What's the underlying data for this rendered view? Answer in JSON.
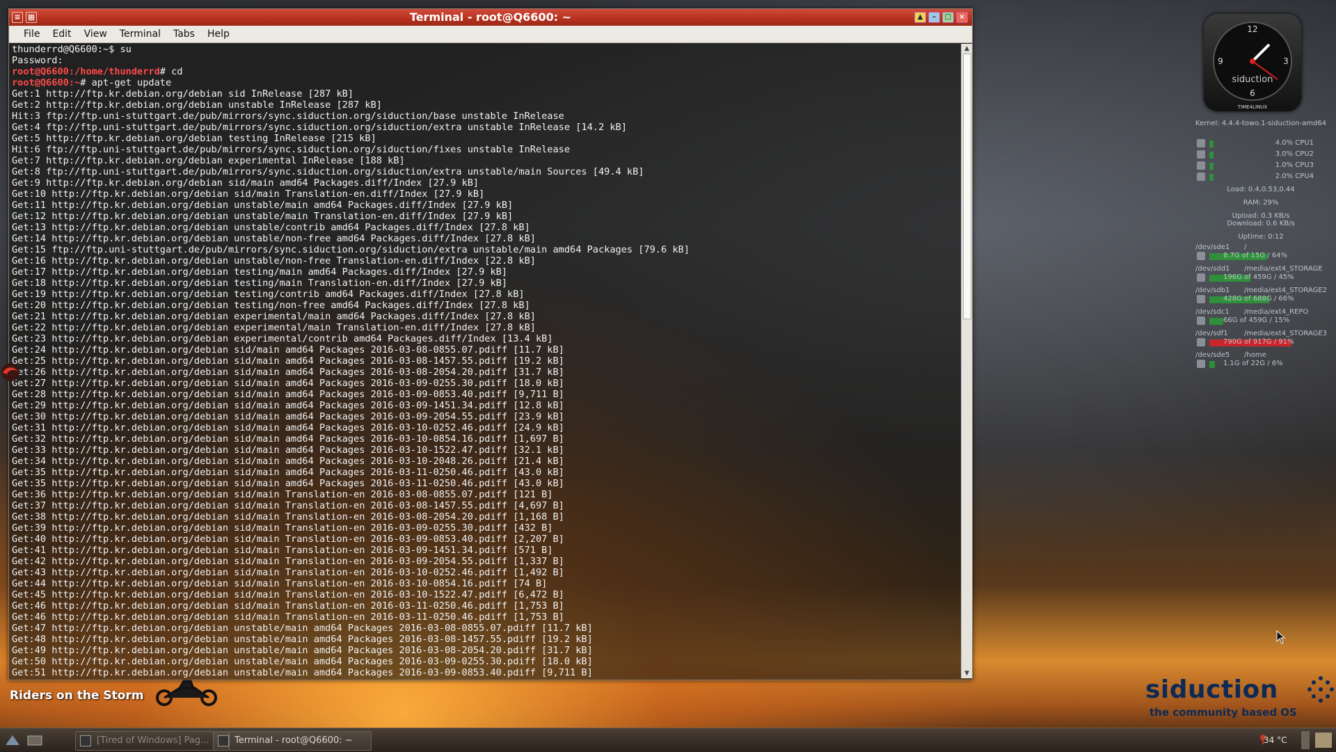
{
  "window": {
    "title": "Terminal - root@Q6600: ~",
    "menu": [
      "File",
      "Edit",
      "View",
      "Terminal",
      "Tabs",
      "Help"
    ]
  },
  "terminal": {
    "lines": [
      {
        "prompt": "",
        "text": "thunderrd@Q6600:~$ su"
      },
      {
        "prompt": "",
        "text": "Password:"
      },
      {
        "prompt": "root@Q6600:/home/thunderrd",
        "text": "# cd"
      },
      {
        "prompt": "root@Q6600:~",
        "text": "# apt-get update"
      },
      {
        "prompt": "",
        "text": "Get:1 http://ftp.kr.debian.org/debian sid InRelease [287 kB]"
      },
      {
        "prompt": "",
        "text": "Get:2 http://ftp.kr.debian.org/debian unstable InRelease [287 kB]"
      },
      {
        "prompt": "",
        "text": "Hit:3 ftp://ftp.uni-stuttgart.de/pub/mirrors/sync.siduction.org/siduction/base unstable InRelease"
      },
      {
        "prompt": "",
        "text": "Get:4 ftp://ftp.uni-stuttgart.de/pub/mirrors/sync.siduction.org/siduction/extra unstable InRelease [14.2 kB]"
      },
      {
        "prompt": "",
        "text": "Get:5 http://ftp.kr.debian.org/debian testing InRelease [215 kB]"
      },
      {
        "prompt": "",
        "text": "Hit:6 ftp://ftp.uni-stuttgart.de/pub/mirrors/sync.siduction.org/siduction/fixes unstable InRelease"
      },
      {
        "prompt": "",
        "text": "Get:7 http://ftp.kr.debian.org/debian experimental InRelease [188 kB]"
      },
      {
        "prompt": "",
        "text": "Get:8 ftp://ftp.uni-stuttgart.de/pub/mirrors/sync.siduction.org/siduction/extra unstable/main Sources [49.4 kB]"
      },
      {
        "prompt": "",
        "text": "Get:9 http://ftp.kr.debian.org/debian sid/main amd64 Packages.diff/Index [27.9 kB]"
      },
      {
        "prompt": "",
        "text": "Get:10 http://ftp.kr.debian.org/debian sid/main Translation-en.diff/Index [27.9 kB]"
      },
      {
        "prompt": "",
        "text": "Get:11 http://ftp.kr.debian.org/debian unstable/main amd64 Packages.diff/Index [27.9 kB]"
      },
      {
        "prompt": "",
        "text": "Get:12 http://ftp.kr.debian.org/debian unstable/main Translation-en.diff/Index [27.9 kB]"
      },
      {
        "prompt": "",
        "text": "Get:13 http://ftp.kr.debian.org/debian unstable/contrib amd64 Packages.diff/Index [27.8 kB]"
      },
      {
        "prompt": "",
        "text": "Get:14 http://ftp.kr.debian.org/debian unstable/non-free amd64 Packages.diff/Index [27.8 kB]"
      },
      {
        "prompt": "",
        "text": "Get:15 ftp://ftp.uni-stuttgart.de/pub/mirrors/sync.siduction.org/siduction/extra unstable/main amd64 Packages [79.6 kB]"
      },
      {
        "prompt": "",
        "text": "Get:16 http://ftp.kr.debian.org/debian unstable/non-free Translation-en.diff/Index [22.8 kB]"
      },
      {
        "prompt": "",
        "text": "Get:17 http://ftp.kr.debian.org/debian testing/main amd64 Packages.diff/Index [27.9 kB]"
      },
      {
        "prompt": "",
        "text": "Get:18 http://ftp.kr.debian.org/debian testing/main Translation-en.diff/Index [27.9 kB]"
      },
      {
        "prompt": "",
        "text": "Get:19 http://ftp.kr.debian.org/debian testing/contrib amd64 Packages.diff/Index [27.8 kB]"
      },
      {
        "prompt": "",
        "text": "Get:20 http://ftp.kr.debian.org/debian testing/non-free amd64 Packages.diff/Index [27.8 kB]"
      },
      {
        "prompt": "",
        "text": "Get:21 http://ftp.kr.debian.org/debian experimental/main amd64 Packages.diff/Index [27.8 kB]"
      },
      {
        "prompt": "",
        "text": "Get:22 http://ftp.kr.debian.org/debian experimental/main Translation-en.diff/Index [27.8 kB]"
      },
      {
        "prompt": "",
        "text": "Get:23 http://ftp.kr.debian.org/debian experimental/contrib amd64 Packages.diff/Index [13.4 kB]"
      },
      {
        "prompt": "",
        "text": "Get:24 http://ftp.kr.debian.org/debian sid/main amd64 Packages 2016-03-08-0855.07.pdiff [11.7 kB]"
      },
      {
        "prompt": "",
        "text": "Get:25 http://ftp.kr.debian.org/debian sid/main amd64 Packages 2016-03-08-1457.55.pdiff [19.2 kB]"
      },
      {
        "prompt": "",
        "text": "Get:26 http://ftp.kr.debian.org/debian sid/main amd64 Packages 2016-03-08-2054.20.pdiff [31.7 kB]"
      },
      {
        "prompt": "",
        "text": "Get:27 http://ftp.kr.debian.org/debian sid/main amd64 Packages 2016-03-09-0255.30.pdiff [18.0 kB]"
      },
      {
        "prompt": "",
        "text": "Get:28 http://ftp.kr.debian.org/debian sid/main amd64 Packages 2016-03-09-0853.40.pdiff [9,711 B]"
      },
      {
        "prompt": "",
        "text": "Get:29 http://ftp.kr.debian.org/debian sid/main amd64 Packages 2016-03-09-1451.34.pdiff [12.8 kB]"
      },
      {
        "prompt": "",
        "text": "Get:30 http://ftp.kr.debian.org/debian sid/main amd64 Packages 2016-03-09-2054.55.pdiff [23.9 kB]"
      },
      {
        "prompt": "",
        "text": "Get:31 http://ftp.kr.debian.org/debian sid/main amd64 Packages 2016-03-10-0252.46.pdiff [24.9 kB]"
      },
      {
        "prompt": "",
        "text": "Get:32 http://ftp.kr.debian.org/debian sid/main amd64 Packages 2016-03-10-0854.16.pdiff [1,697 B]"
      },
      {
        "prompt": "",
        "text": "Get:33 http://ftp.kr.debian.org/debian sid/main amd64 Packages 2016-03-10-1522.47.pdiff [32.1 kB]"
      },
      {
        "prompt": "",
        "text": "Get:34 http://ftp.kr.debian.org/debian sid/main amd64 Packages 2016-03-10-2048.26.pdiff [21.4 kB]"
      },
      {
        "prompt": "",
        "text": "Get:35 http://ftp.kr.debian.org/debian sid/main amd64 Packages 2016-03-11-0250.46.pdiff [43.0 kB]"
      },
      {
        "prompt": "",
        "text": "Get:35 http://ftp.kr.debian.org/debian sid/main amd64 Packages 2016-03-11-0250.46.pdiff [43.0 kB]"
      },
      {
        "prompt": "",
        "text": "Get:36 http://ftp.kr.debian.org/debian sid/main Translation-en 2016-03-08-0855.07.pdiff [121 B]"
      },
      {
        "prompt": "",
        "text": "Get:37 http://ftp.kr.debian.org/debian sid/main Translation-en 2016-03-08-1457.55.pdiff [4,697 B]"
      },
      {
        "prompt": "",
        "text": "Get:38 http://ftp.kr.debian.org/debian sid/main Translation-en 2016-03-08-2054.20.pdiff [1,168 B]"
      },
      {
        "prompt": "",
        "text": "Get:39 http://ftp.kr.debian.org/debian sid/main Translation-en 2016-03-09-0255.30.pdiff [432 B]"
      },
      {
        "prompt": "",
        "text": "Get:40 http://ftp.kr.debian.org/debian sid/main Translation-en 2016-03-09-0853.40.pdiff [2,207 B]"
      },
      {
        "prompt": "",
        "text": "Get:41 http://ftp.kr.debian.org/debian sid/main Translation-en 2016-03-09-1451.34.pdiff [571 B]"
      },
      {
        "prompt": "",
        "text": "Get:42 http://ftp.kr.debian.org/debian sid/main Translation-en 2016-03-09-2054.55.pdiff [1,337 B]"
      },
      {
        "prompt": "",
        "text": "Get:43 http://ftp.kr.debian.org/debian sid/main Translation-en 2016-03-10-0252.46.pdiff [1,492 B]"
      },
      {
        "prompt": "",
        "text": "Get:44 http://ftp.kr.debian.org/debian sid/main Translation-en 2016-03-10-0854.16.pdiff [74 B]"
      },
      {
        "prompt": "",
        "text": "Get:45 http://ftp.kr.debian.org/debian sid/main Translation-en 2016-03-10-1522.47.pdiff [6,472 B]"
      },
      {
        "prompt": "",
        "text": "Get:46 http://ftp.kr.debian.org/debian sid/main Translation-en 2016-03-11-0250.46.pdiff [1,753 B]"
      },
      {
        "prompt": "",
        "text": "Get:46 http://ftp.kr.debian.org/debian sid/main Translation-en 2016-03-11-0250.46.pdiff [1,753 B]"
      },
      {
        "prompt": "",
        "text": "Get:47 http://ftp.kr.debian.org/debian unstable/main amd64 Packages 2016-03-08-0855.07.pdiff [11.7 kB]"
      },
      {
        "prompt": "",
        "text": "Get:48 http://ftp.kr.debian.org/debian unstable/main amd64 Packages 2016-03-08-1457.55.pdiff [19.2 kB]"
      },
      {
        "prompt": "",
        "text": "Get:49 http://ftp.kr.debian.org/debian unstable/main amd64 Packages 2016-03-08-2054.20.pdiff [31.7 kB]"
      },
      {
        "prompt": "",
        "text": "Get:50 http://ftp.kr.debian.org/debian unstable/main amd64 Packages 2016-03-09-0255.30.pdiff [18.0 kB]"
      },
      {
        "prompt": "",
        "text": "Get:51 http://ftp.kr.debian.org/debian unstable/main amd64 Packages 2016-03-09-0853.40.pdiff [9,711 B]"
      }
    ]
  },
  "desktop": {
    "song_title": "Riders on the Storm",
    "clock": {
      "n12": "12",
      "n3": "3",
      "n6": "6",
      "n9": "9",
      "brand": "siduction",
      "footer": "TIME4LINUX"
    },
    "conky": {
      "kernel": "Kernel: 4.4.4-towo.1-siduction-amd64",
      "cpus": [
        {
          "label": "4.0% CPU1"
        },
        {
          "label": "3.0% CPU2"
        },
        {
          "label": "1.0% CPU3"
        },
        {
          "label": "2.0% CPU4"
        }
      ],
      "load": "Load: 0.4,0.53,0.44",
      "ram": "RAM: 29%",
      "upload": "Upload: 0.3 KB/s",
      "download": "Download: 0.6 KB/s",
      "uptime": "Uptime: 0:12",
      "disks": [
        {
          "dev": "/dev/sde1",
          "mount": "/",
          "usage": "8.7G of 15G / 64%",
          "pct": 64
        },
        {
          "dev": "/dev/sdd1",
          "mount": "/media/ext4_STORAGE",
          "usage": "196G of 459G / 45%",
          "pct": 45
        },
        {
          "dev": "/dev/sdb1",
          "mount": "/media/ext4_STORAGE2",
          "usage": "428G of 688G / 66%",
          "pct": 66
        },
        {
          "dev": "/dev/sdc1",
          "mount": "/media/ext4_REPO",
          "usage": "66G of 459G / 15%",
          "pct": 15
        },
        {
          "dev": "/dev/sdf1",
          "mount": "/media/ext4_STORAGE3",
          "usage": "790G of 917G / 91%",
          "pct": 91
        },
        {
          "dev": "/dev/sde5",
          "mount": "/home",
          "usage": "1.1G of 22G / 6%",
          "pct": 6
        }
      ]
    },
    "logo": {
      "word": "siduction",
      "tagline": "the community based OS"
    }
  },
  "taskbar": {
    "task_inactive": "[Tired of Windows] Pag...",
    "task_active": "Terminal - root@Q6600: ~",
    "temperature": "34 °C"
  },
  "colors": {
    "prompt": "#ff4a4a",
    "titlebar": "#b8321f",
    "disk_ok": "#2f8f3a",
    "disk_critical": "#c9262b"
  }
}
